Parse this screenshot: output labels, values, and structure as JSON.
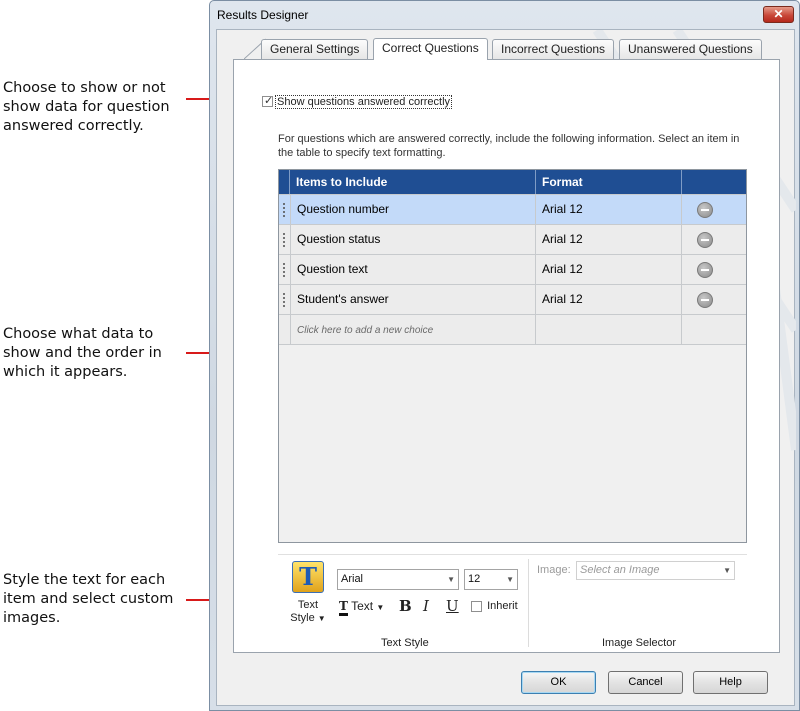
{
  "annotations": {
    "first": "Choose to show or not show data for question answered correctly.",
    "second": "Choose what data to show and the order in which it appears.",
    "third": "Style the text for each item and select custom images."
  },
  "window": {
    "title": "Results Designer",
    "close_glyph": "✕"
  },
  "tabs": [
    {
      "label": "General Settings"
    },
    {
      "label": "Correct Questions"
    },
    {
      "label": "Incorrect Questions"
    },
    {
      "label": "Unanswered Questions"
    }
  ],
  "show_correct": {
    "checked": true,
    "label": "Show questions answered correctly"
  },
  "description": "For questions which are answered correctly, include the following information. Select an item in the table to specify text formatting.",
  "grid": {
    "headers": {
      "items": "Items to Include",
      "format": "Format"
    },
    "rows": [
      {
        "item": "Question number",
        "format": "Arial 12"
      },
      {
        "item": "Question status",
        "format": "Arial 12"
      },
      {
        "item": "Question text",
        "format": "Arial 12"
      },
      {
        "item": "Student's answer",
        "format": "Arial 12"
      }
    ],
    "add_placeholder": "Click here to add a new choice"
  },
  "text_style": {
    "icon_glyph": "T",
    "button_label": "Text Style",
    "font": "Arial",
    "size": "12",
    "text_color_label": "Text",
    "bold": "B",
    "italic": "I",
    "underline": "U",
    "inherit_label": "Inherit",
    "group_label": "Text Style"
  },
  "image_selector": {
    "label": "Image:",
    "placeholder": "Select an Image",
    "group_label": "Image Selector"
  },
  "buttons": {
    "ok": "OK",
    "cancel": "Cancel",
    "help": "Help"
  },
  "colors": {
    "annotation_red": "#d81a1a",
    "grid_header": "#1f4e93",
    "selected_row": "#c3daf9"
  }
}
